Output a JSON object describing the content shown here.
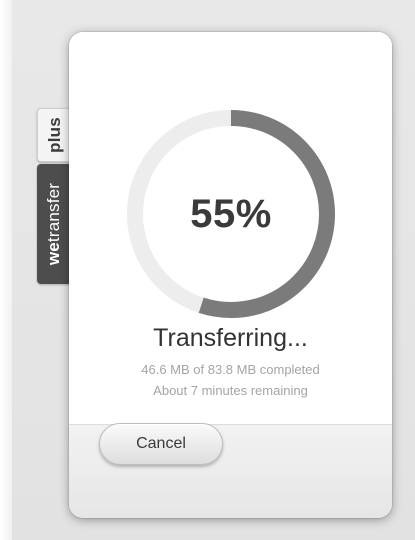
{
  "side_tabs": {
    "plus_label": "plus",
    "brand_prefix": "we",
    "brand_suffix": "transfer"
  },
  "transfer": {
    "percent_text": "55%",
    "progress_fraction": 0.55,
    "status_title": "Transferring...",
    "progress_detail": "46.6 MB of 83.8 MB completed",
    "eta": "About 7 minutes remaining"
  },
  "actions": {
    "cancel_label": "Cancel"
  },
  "colors": {
    "ring_track": "#ededed",
    "ring_fill": "#7b7b7b",
    "brand_tab": "#4d4d4d"
  }
}
